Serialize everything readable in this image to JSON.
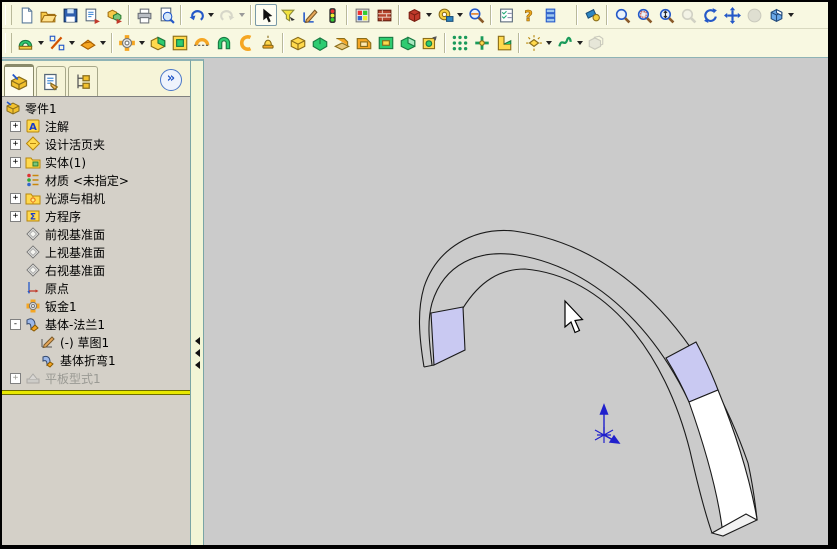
{
  "colors": {
    "toolbar_bg": "#f8f8e1",
    "viewport_bg": "#cbcbcb",
    "panel_bg": "#d4d0c8",
    "selection_highlight": "#c9c9f2",
    "preview_face": "#ffffff",
    "rollback_bar": "#e8e800",
    "origin_triad": "#2020cc",
    "active_tab_accent": "#f0a500"
  },
  "toolbar_standard": {
    "icons": [
      "new-icon",
      "open-icon",
      "save-icon",
      "make-drawing-icon",
      "make-assembly-icon",
      "print-icon",
      "print-preview-icon",
      "undo-icon",
      "redo-icon",
      "select-arrow-icon",
      "selection-filter-icon",
      "sketch-icon",
      "rebuild-icon",
      "color-swatch-icon",
      "edit-material-icon",
      "3d-content-icon",
      "measure-icon",
      "design-checker-icon",
      "options-icon",
      "help-icon",
      "file-properties-icon"
    ]
  },
  "toolbar_view": {
    "icons": [
      "view-orientation-icon",
      "zoom-to-fit-icon",
      "zoom-to-area-icon",
      "zoom-in-out-icon",
      "zoom-to-selection-icon",
      "rotate-view-icon",
      "pan-icon",
      "shaded-icon",
      "display-style-icon"
    ]
  },
  "toolbar_sheet_metal": {
    "icons": [
      "features-icon",
      "sketch-tools-icon",
      "surfaces-icon",
      "sheet-metal-gear-icon",
      "base-flange-icon",
      "edge-flange-icon",
      "miter-flange-icon",
      "hem-icon",
      "jog-icon",
      "sketched-bend-icon",
      "closed-corner-icon",
      "welded-corner-icon",
      "break-corner-icon",
      "corner-trim-icon",
      "forming-tool-icon",
      "extruded-cut-icon",
      "vent-icon",
      "linear-pattern-icon",
      "flex-icon",
      "unfold-fold-icon",
      "insert-bends-icon",
      "rip-icon",
      "no-bends-icon"
    ]
  },
  "panel": {
    "chevron": "»",
    "tabs": [
      "featuremanager",
      "propertymanager",
      "configurationmanager"
    ]
  },
  "tree": {
    "items": [
      {
        "label": "零件1",
        "expand": "",
        "icon": "part-icon"
      },
      {
        "label": "注解",
        "expand": "+",
        "icon": "annotations-icon"
      },
      {
        "label": "设计活页夹",
        "expand": "+",
        "icon": "design-binder-icon"
      },
      {
        "label": "实体(1)",
        "expand": "+",
        "icon": "solid-bodies-icon"
      },
      {
        "label": "材质 <未指定>",
        "expand": "",
        "icon": "material-icon"
      },
      {
        "label": "光源与相机",
        "expand": "+",
        "icon": "lights-cameras-icon"
      },
      {
        "label": "方程序",
        "expand": "+",
        "icon": "equations-icon"
      },
      {
        "label": "前视基准面",
        "expand": "",
        "icon": "plane-icon"
      },
      {
        "label": "上视基准面",
        "expand": "",
        "icon": "plane-icon"
      },
      {
        "label": "右视基准面",
        "expand": "",
        "icon": "plane-icon"
      },
      {
        "label": "原点",
        "expand": "",
        "icon": "origin-icon"
      },
      {
        "label": "钣金1",
        "expand": "",
        "icon": "sheet-metal-icon"
      },
      {
        "label": "基体-法兰1",
        "expand": "-",
        "icon": "base-flange-feature-icon"
      },
      {
        "label": "(-) 草图1",
        "expand": "",
        "icon": "sketch-feature-icon"
      },
      {
        "label": "基体折弯1",
        "expand": "",
        "icon": "base-bend-icon"
      },
      {
        "label": "平板型式1",
        "expand": "+",
        "icon": "flat-pattern-icon",
        "grayed": true
      }
    ]
  },
  "viewport": {
    "model": "sheet-metal-arc-wireframe",
    "selected_faces": 2
  }
}
